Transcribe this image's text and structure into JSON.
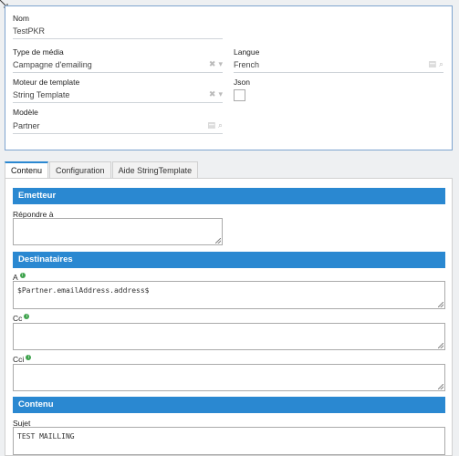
{
  "form": {
    "nom": {
      "label": "Nom",
      "value": "TestPKR"
    },
    "type_media": {
      "label": "Type de média",
      "value": "Campagne d'emailing"
    },
    "langue": {
      "label": "Langue",
      "value": "French"
    },
    "moteur": {
      "label": "Moteur de template",
      "value": "String Template"
    },
    "json": {
      "label": "Json"
    },
    "modele": {
      "label": "Modèle",
      "value": "Partner"
    }
  },
  "tabs": [
    "Contenu",
    "Configuration",
    "Aide StringTemplate"
  ],
  "sections": {
    "emetteur": {
      "title": "Emetteur",
      "repondre_label": "Répondre à",
      "repondre_value": ""
    },
    "destinataires": {
      "title": "Destinataires",
      "a_label": "A",
      "a_value": "$Partner.emailAddress.address$",
      "cc_label": "Cc",
      "cc_value": "",
      "cci_label": "Cci",
      "cci_value": ""
    },
    "contenu": {
      "title": "Contenu",
      "sujet_label": "Sujet",
      "sujet_value": "TEST MAILLING"
    }
  }
}
